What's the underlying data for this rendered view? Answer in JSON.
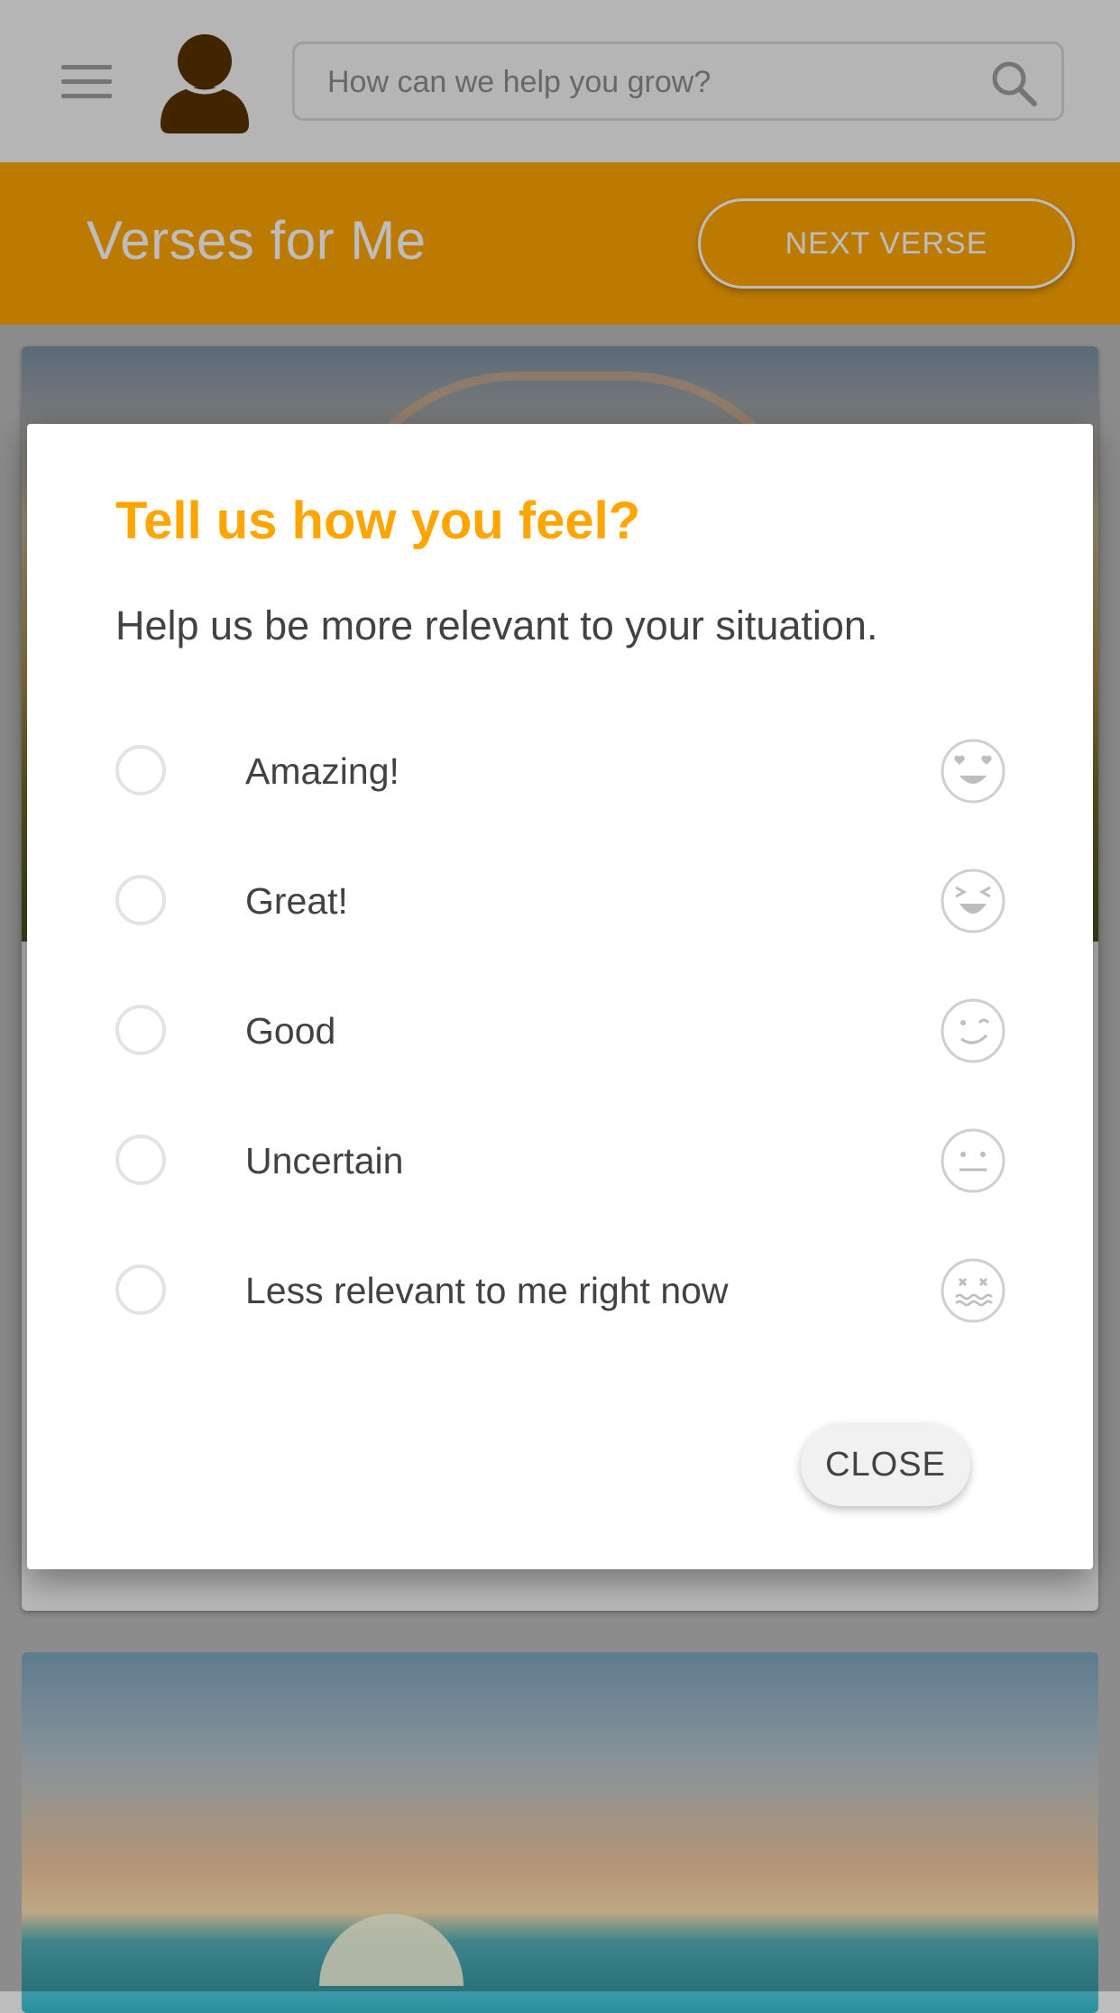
{
  "colors": {
    "accent": "#ffa500",
    "avatar": "#7a4a00",
    "dialog_text": "#424242"
  },
  "topbar": {
    "menu_icon": "hamburger-icon",
    "avatar_icon": "user-avatar-icon",
    "search_placeholder": "How can we help you grow?",
    "search_icon": "search-icon"
  },
  "header": {
    "title": "Verses for Me",
    "next_button": "NEXT VERSE"
  },
  "dialog": {
    "title": "Tell us how you feel?",
    "subtitle": "Help us be more relevant to your situation.",
    "options": [
      {
        "label": "Amazing!",
        "icon": "heart-eyes-emoji-icon"
      },
      {
        "label": "Great!",
        "icon": "laughing-emoji-icon"
      },
      {
        "label": "Good",
        "icon": "winking-emoji-icon"
      },
      {
        "label": "Uncertain",
        "icon": "neutral-face-emoji-icon"
      },
      {
        "label": "Less relevant to me right now",
        "icon": "dizzy-face-emoji-icon"
      }
    ],
    "close_button": "CLOSE"
  }
}
